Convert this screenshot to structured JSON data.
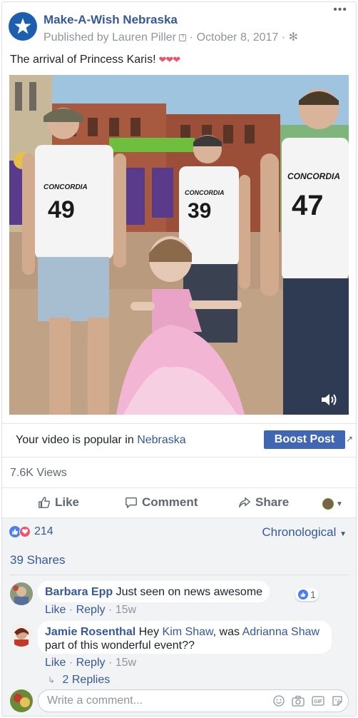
{
  "post": {
    "page_name": "Make-A-Wish Nebraska",
    "published_by": "Published by Lauren Piller",
    "date": "October 8, 2017",
    "more_label": "•••",
    "text": "The arrival of Princess Karis!",
    "hearts": "❤❤❤",
    "video_jerseys": [
      "CONCORDIA",
      "CONCORDIA",
      "CONCORDIA"
    ],
    "video_numbers": [
      "49",
      "39",
      "47"
    ]
  },
  "popular": {
    "prefix": "Your video is popular in",
    "location": "Nebraska",
    "boost_label": "Boost Post"
  },
  "stats": {
    "views": "7.6K Views",
    "reaction_count": "214",
    "order": "Chronological",
    "shares": "39 Shares"
  },
  "actions": {
    "like": "Like",
    "comment": "Comment",
    "share": "Share"
  },
  "comments": [
    {
      "author": "Barbara Epp",
      "text": "Just seen on news awesome",
      "like_count": "1",
      "like_label": "Like",
      "reply_label": "Reply",
      "time": "15w"
    },
    {
      "author": "Jamie Rosenthal",
      "text_before": "Hey",
      "mention_1": "Kim Shaw",
      "text_middle": ", was",
      "mention_2": "Adrianna Shaw",
      "text_after": "part of this wonderful event??",
      "like_label": "Like",
      "reply_label": "Reply",
      "time": "15w",
      "replies_label": "2 Replies"
    }
  ],
  "composer": {
    "placeholder": "Write a comment..."
  },
  "colors": {
    "link_blue": "#365899",
    "boost_blue": "#4267b2",
    "love_red": "#f25268"
  }
}
